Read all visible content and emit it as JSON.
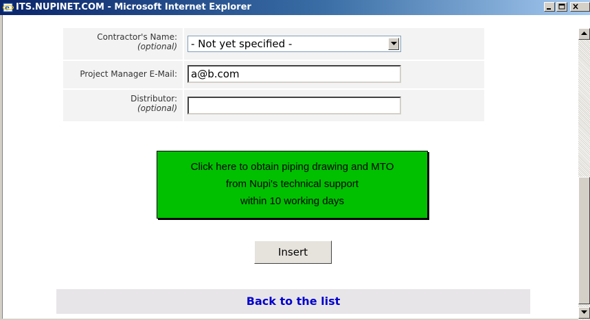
{
  "window": {
    "title": "ITS.NUPINET.COM - Microsoft Internet Explorer"
  },
  "form": {
    "contractor": {
      "label": "Contractor's Name:",
      "optional_note": "(optional)",
      "selected_value": "- Not yet specified -"
    },
    "project_manager_email": {
      "label": "Project Manager E-Mail:",
      "value": "a@b.com"
    },
    "distributor": {
      "label": "Distributor:",
      "optional_note": "(optional)",
      "value": ""
    }
  },
  "support_button": {
    "line1": "Click here to obtain piping drawing and MTO",
    "line2": "from Nupi's technical support",
    "line3": "within 10 working days",
    "color": "#00c000"
  },
  "insert_button": {
    "label": "Insert"
  },
  "back_link": {
    "label": "Back to the list",
    "color": "#0000cc"
  }
}
